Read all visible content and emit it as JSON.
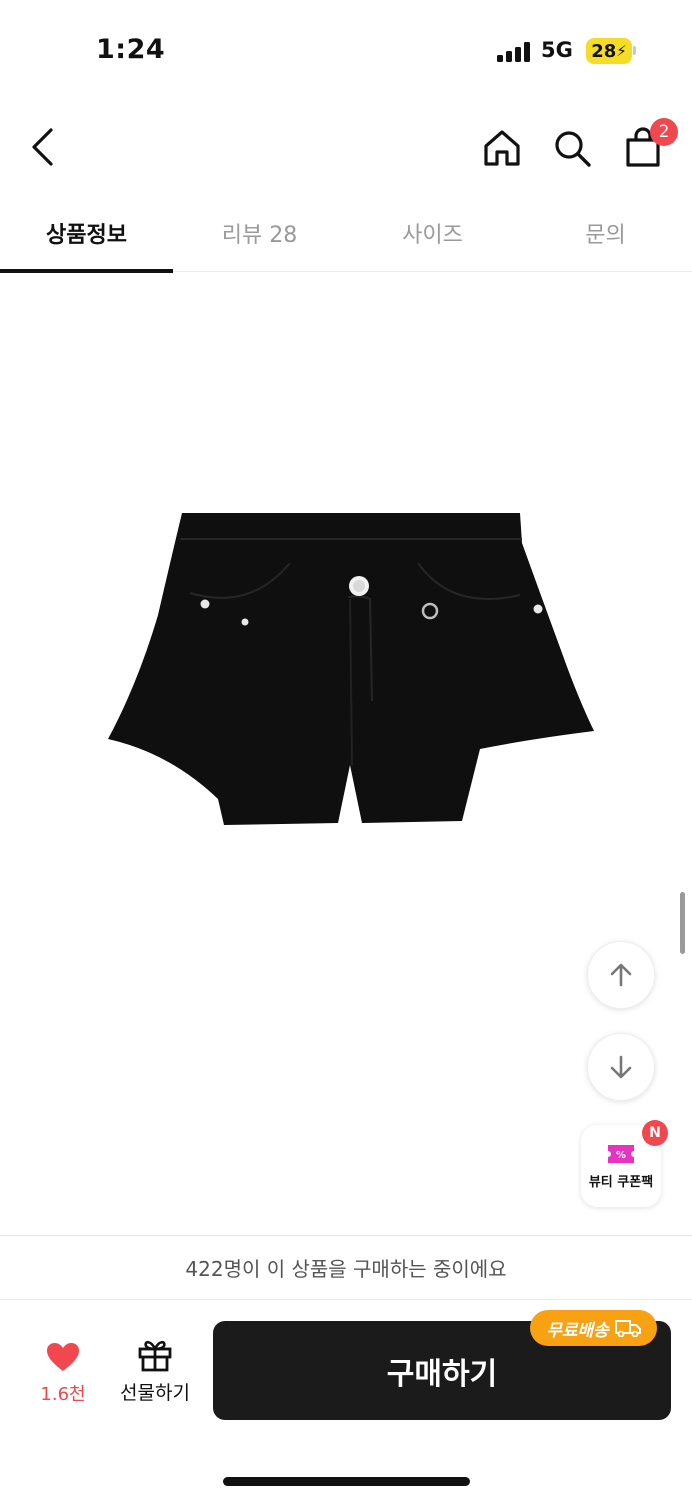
{
  "status_bar": {
    "time": "1:24",
    "network": "5G",
    "battery": "28"
  },
  "nav": {
    "cart_count": "2"
  },
  "tabs": [
    {
      "label": "상품정보",
      "active": true
    },
    {
      "label": "리뷰 28",
      "active": false
    },
    {
      "label": "사이즈",
      "active": false
    },
    {
      "label": "문의",
      "active": false
    }
  ],
  "product": {
    "image": "black-denim-shorts",
    "color": "#0f0f0f"
  },
  "floating": {
    "up_icon": "arrow-up-icon",
    "down_icon": "arrow-down-icon",
    "coupon_label": "뷰티 쿠폰팩",
    "coupon_badge": "N"
  },
  "bottom_bar": {
    "notice": "422명이 이 상품을 구매하는 중이에요",
    "like_count": "1.6천",
    "gift_label": "선물하기",
    "buy_label": "구매하기",
    "free_shipping_label": "무료배송"
  },
  "colors": {
    "accent_red": "#f1474f",
    "buy_button": "#1b1b1b",
    "free_shipping": "#f7a113",
    "battery": "#f5dd25"
  }
}
